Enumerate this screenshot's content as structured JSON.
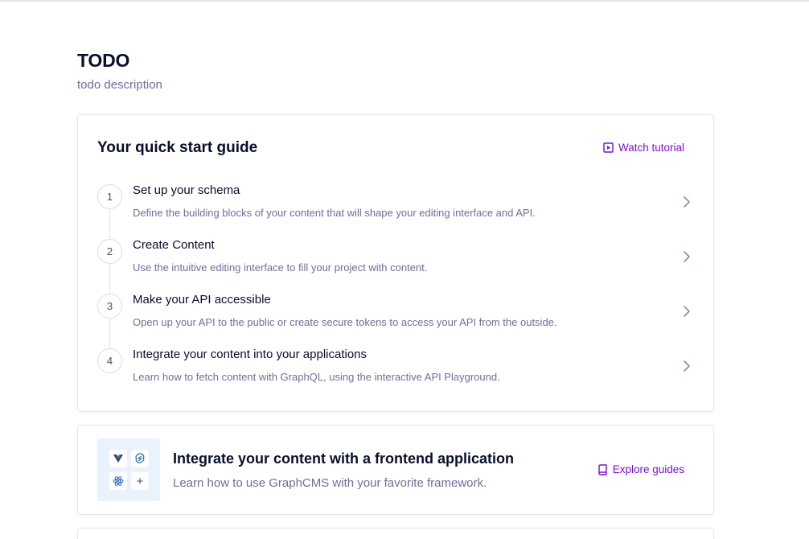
{
  "page": {
    "title": "TODO",
    "description": "todo description"
  },
  "guide": {
    "title": "Your quick start guide",
    "watch_label": "Watch tutorial",
    "steps": [
      {
        "number": "1",
        "title": "Set up your schema",
        "description": "Define the building blocks of your content that will shape your editing interface and API."
      },
      {
        "number": "2",
        "title": "Create Content",
        "description": "Use the intuitive editing interface to fill your project with content."
      },
      {
        "number": "3",
        "title": "Make your API accessible",
        "description": "Open up your API to the public or create secure tokens to access your API from the outside."
      },
      {
        "number": "4",
        "title": "Integrate your content into your applications",
        "description": "Learn how to fetch content with GraphQL, using the interactive API Playground."
      }
    ]
  },
  "integrate": {
    "title": "Integrate your content with a frontend application",
    "description": "Learn how to use GraphCMS with your favorite framework.",
    "explore_label": "Explore guides",
    "frameworks": [
      "vue-icon",
      "svelte-icon",
      "react-icon",
      "plus-icon"
    ],
    "plus_glyph": "+"
  },
  "colors": {
    "accent": "#7b12c9",
    "heading": "#090e2a",
    "muted": "#6d6f9a",
    "tile_bg": "#eaf3fd"
  }
}
